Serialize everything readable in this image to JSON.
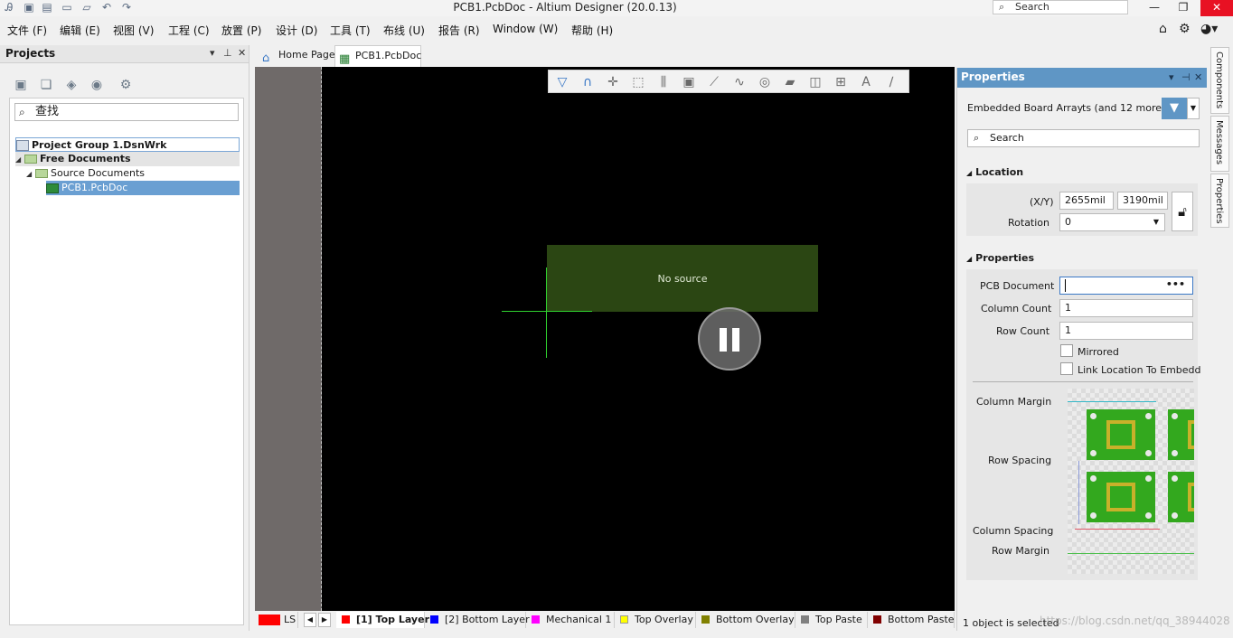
{
  "window": {
    "title": "PCB1.PcbDoc - Altium Designer (20.0.13)",
    "search_placeholder": "Search",
    "minimize": "—",
    "restore": "❐",
    "close": "✕"
  },
  "menu": [
    "文件 (F)",
    "编辑 (E)",
    "视图 (V)",
    "工程 (C)",
    "放置 (P)",
    "设计 (D)",
    "工具 (T)",
    "布线 (U)",
    "报告 (R)",
    "Window (W)",
    "帮助 (H)"
  ],
  "projects": {
    "title": "Projects",
    "search_placeholder": "查找",
    "tree": {
      "group": "Project Group 1.DsnWrk",
      "free_docs": "Free Documents",
      "source_docs": "Source Documents",
      "pcb_doc": "PCB1.PcbDoc"
    }
  },
  "tabs": {
    "home": "Home Page",
    "pcb": "PCB1.PcbDoc"
  },
  "canvas": {
    "no_source": "No source"
  },
  "layers": {
    "ls": "LS",
    "items": [
      {
        "label": "[1] Top Layer",
        "color": "#ff0000"
      },
      {
        "label": "[2] Bottom Layer",
        "color": "#0000ff"
      },
      {
        "label": "Mechanical 1",
        "color": "#ff00ff"
      },
      {
        "label": "Top Overlay",
        "color": "#ffff00"
      },
      {
        "label": "Bottom Overlay",
        "color": "#808000"
      },
      {
        "label": "Top Paste",
        "color": "#808080"
      },
      {
        "label": "Bottom Paste",
        "color": "#800000"
      }
    ]
  },
  "properties": {
    "title": "Properties",
    "object_type": "Embedded Board Array",
    "object_more": "ts (and 12 more)",
    "search_placeholder": "Search",
    "location": {
      "heading": "Location",
      "xy_label": "(X/Y)",
      "x": "2655mil",
      "y": "3190mil",
      "rotation_label": "Rotation",
      "rotation": "0"
    },
    "props": {
      "heading": "Properties",
      "pcb_document_label": "PCB Document",
      "pcb_document": "",
      "column_count_label": "Column Count",
      "column_count": "1",
      "row_count_label": "Row Count",
      "row_count": "1",
      "mirrored_label": "Mirrored",
      "link_label": "Link Location To Embedd"
    },
    "diagram": {
      "column_margin": "Column Margin",
      "row_spacing": "Row Spacing",
      "column_spacing": "Column Spacing",
      "row_margin": "Row Margin"
    },
    "status": "1 object is selected"
  },
  "side_tabs": [
    "Components",
    "Messages",
    "Properties"
  ],
  "watermark": "https://blog.csdn.net/qq_38944028"
}
